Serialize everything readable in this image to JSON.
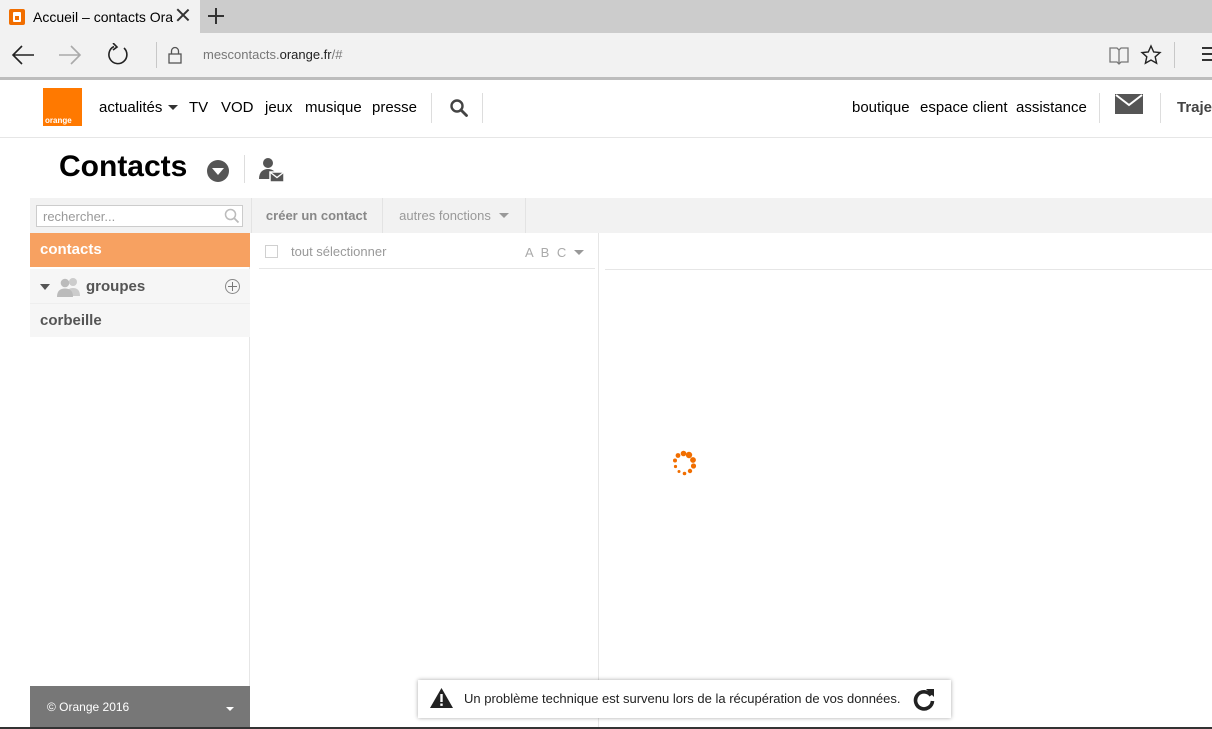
{
  "browser": {
    "tab_title": "Accueil – contacts Oran",
    "url_prefix": "mescontacts.",
    "url_domain": "orange.fr",
    "url_suffix": "/#"
  },
  "header": {
    "logo_text": "orange",
    "nav": [
      "actualités",
      "TV",
      "VOD",
      "jeux",
      "musique",
      "presse"
    ],
    "right_nav": [
      "boutique",
      "espace client",
      "assistance"
    ],
    "trajet_label": "Trajec"
  },
  "page": {
    "title": "Contacts"
  },
  "toolbar": {
    "search_placeholder": "rechercher...",
    "create_label": "créer un contact",
    "more_label": "autres fonctions"
  },
  "sidebar": {
    "contacts_label": "contacts",
    "groups_label": "groupes",
    "trash_label": "corbeille",
    "footer_text": "© Orange 2016"
  },
  "list": {
    "select_all_label": "tout sélectionner",
    "sort_label": "A B C"
  },
  "notice": {
    "message": "Un problème technique est survenu lors de la récupération de vos données."
  },
  "colors": {
    "orange": "#ff7900",
    "sidebar_active": "#f7a161",
    "footer_bg": "#777777"
  }
}
